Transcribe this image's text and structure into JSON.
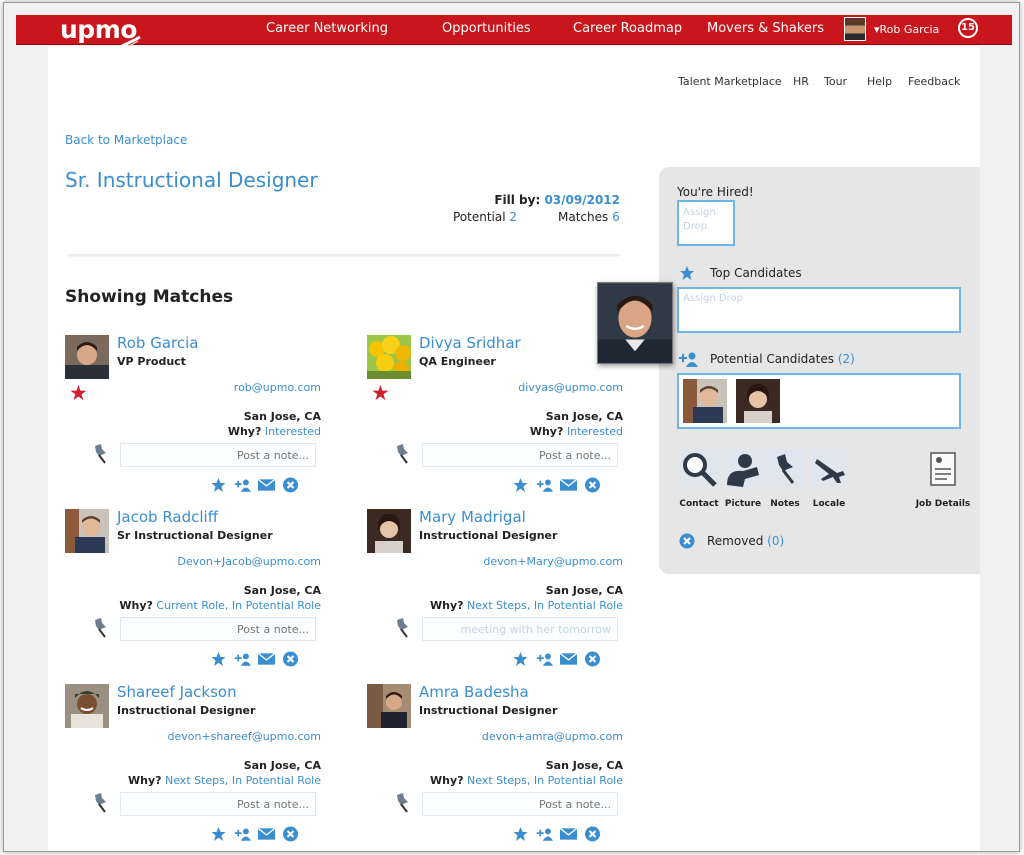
{
  "brand": {
    "logo_text": "upmo",
    "bar_color": "#c8161c",
    "accent": "#3a8ed0"
  },
  "topnav": {
    "items": [
      {
        "label": "Career Networking"
      },
      {
        "label": "Opportunities"
      },
      {
        "label": "Career Roadmap"
      },
      {
        "label": "Movers & Shakers"
      }
    ],
    "user_name": "▾Rob Garcia",
    "notification_count": "15"
  },
  "subnav": {
    "items": [
      {
        "label": "Talent Marketplace"
      },
      {
        "label": "HR"
      },
      {
        "label": "Tour"
      },
      {
        "label": "Help"
      },
      {
        "label": "Feedback"
      }
    ]
  },
  "job": {
    "back_label": "Back to Marketplace",
    "title": "Sr. Instructional Designer",
    "fill_by_label": "Fill by:",
    "fill_by_date": "03/09/2012",
    "potential_label": "Potential",
    "potential_count": "2",
    "matches_label": "Matches",
    "matches_count": "6"
  },
  "showing_label": "Showing Matches",
  "note_placeholder": "Post a note...",
  "why_label": "Why?",
  "candidates": [
    {
      "name": "Rob Garcia",
      "role": "VP Product",
      "email": "rob@upmo.com",
      "location": "San Jose, CA",
      "why": "Interested",
      "starred": true,
      "note": ""
    },
    {
      "name": "Divya Sridhar",
      "role": "QA Engineer",
      "email": "divyas@upmo.com",
      "location": "San Jose, CA",
      "why": "Interested",
      "starred": true,
      "note": ""
    },
    {
      "name": "Jacob Radcliff",
      "role": "Sr Instructional Designer",
      "email": "Devon+Jacob@upmo.com",
      "location": "San Jose, CA",
      "why": "Current Role, In Potential Role",
      "starred": false,
      "note": ""
    },
    {
      "name": "Mary Madrigal",
      "role": "Instructional Designer",
      "email": "devon+Mary@upmo.com",
      "location": "San Jose, CA",
      "why": "Next Steps, In Potential Role",
      "starred": false,
      "note": "meeting with her tomorrow"
    },
    {
      "name": "Shareef Jackson",
      "role": "Instructional Designer",
      "email": "devon+shareef@upmo.com",
      "location": "San Jose, CA",
      "why": "Next Steps, In Potential Role",
      "starred": false,
      "note": ""
    },
    {
      "name": "Amra Badesha",
      "role": "Instructional Designer",
      "email": "devon+amra@upmo.com",
      "location": "San Jose, CA",
      "why": "Next Steps, In Potential Role",
      "starred": false,
      "note": ""
    }
  ],
  "panel": {
    "hired_label": "You're Hired!",
    "hired_placeholder": "Assign Drop",
    "top_label": "Top Candidates",
    "top_placeholder": "Assign Drop",
    "potential_label": "Potential Candidates",
    "potential_count": "(2)",
    "tools": [
      {
        "label": "Contact",
        "icon": "magnifier-icon"
      },
      {
        "label": "Picture",
        "icon": "person-icon"
      },
      {
        "label": "Notes",
        "icon": "pushpin-icon"
      },
      {
        "label": "Locale",
        "icon": "airplane-icon"
      },
      {
        "label": "Job Details",
        "icon": "document-icon"
      }
    ],
    "removed_label": "Removed",
    "removed_count": "(0)"
  }
}
